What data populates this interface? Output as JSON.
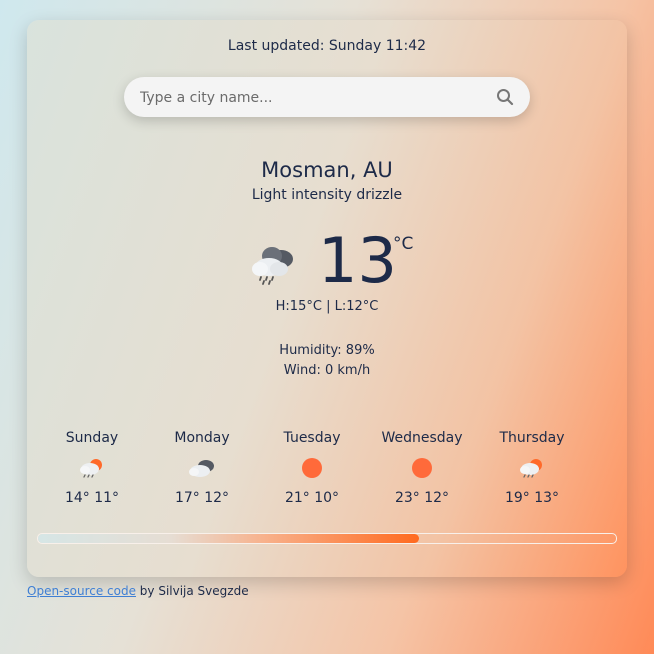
{
  "header": {
    "last_updated": "Last updated: Sunday 11:42"
  },
  "search": {
    "placeholder": "Type a city name...",
    "icon": "search-icon"
  },
  "current": {
    "city": "Mosman, AU",
    "description": "Light intensity drizzle",
    "icon": "rain-cloud-icon",
    "temperature": "13",
    "unit": "°C",
    "high_low": "H:15°C | L:12°C",
    "humidity": "Humidity: 89%",
    "wind": "Wind: 0 km/h"
  },
  "forecast": [
    {
      "day": "Sunday",
      "temps": "14° 11°",
      "icon": "sun-rain-cloud-icon"
    },
    {
      "day": "Monday",
      "temps": "17° 12°",
      "icon": "cloudy-icon"
    },
    {
      "day": "Tuesday",
      "temps": "21° 10°",
      "icon": "sun-icon"
    },
    {
      "day": "Wednesday",
      "temps": "23° 12°",
      "icon": "sun-icon"
    },
    {
      "day": "Thursday",
      "temps": "19° 13°",
      "icon": "sun-rain-cloud-icon"
    }
  ],
  "progress": {
    "percent": 66
  },
  "footer": {
    "link_text": "Open-source code",
    "suffix": " by Silvija Svegzde"
  },
  "colors": {
    "accent": "#ff6a2a",
    "text": "#1d2a48",
    "link": "#3f7fd4"
  }
}
